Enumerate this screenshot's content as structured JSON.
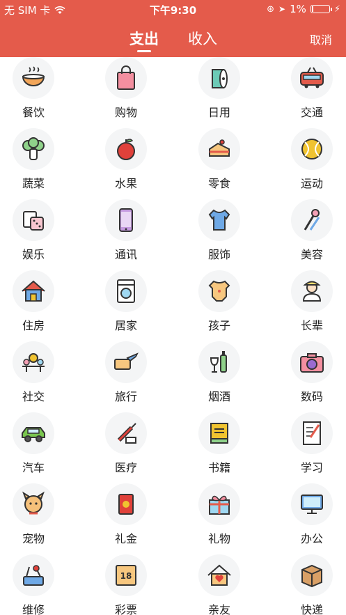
{
  "status": {
    "carrier": "无 SIM 卡",
    "time": "下午9:30",
    "battery": "1%"
  },
  "tabs": [
    "支出",
    "收入"
  ],
  "cancel": "取消",
  "categories": [
    {
      "label": "餐饮",
      "icon": "bowl-icon"
    },
    {
      "label": "购物",
      "icon": "shopping-bag-icon"
    },
    {
      "label": "日用",
      "icon": "paper-roll-icon"
    },
    {
      "label": "交通",
      "icon": "train-icon"
    },
    {
      "label": "蔬菜",
      "icon": "vegetable-icon"
    },
    {
      "label": "水果",
      "icon": "apple-icon"
    },
    {
      "label": "零食",
      "icon": "cake-icon"
    },
    {
      "label": "运动",
      "icon": "ball-icon"
    },
    {
      "label": "娱乐",
      "icon": "dice-icon"
    },
    {
      "label": "通讯",
      "icon": "phone-icon"
    },
    {
      "label": "服饰",
      "icon": "tshirt-icon"
    },
    {
      "label": "美容",
      "icon": "makeup-brush-icon"
    },
    {
      "label": "住房",
      "icon": "house-icon"
    },
    {
      "label": "居家",
      "icon": "washing-machine-icon"
    },
    {
      "label": "孩子",
      "icon": "baby-clothes-icon"
    },
    {
      "label": "长辈",
      "icon": "elder-icon"
    },
    {
      "label": "社交",
      "icon": "dinner-table-icon"
    },
    {
      "label": "旅行",
      "icon": "plane-ticket-icon"
    },
    {
      "label": "烟酒",
      "icon": "wine-icon"
    },
    {
      "label": "数码",
      "icon": "camera-icon"
    },
    {
      "label": "汽车",
      "icon": "car-icon"
    },
    {
      "label": "医疗",
      "icon": "syringe-icon"
    },
    {
      "label": "书籍",
      "icon": "book-icon"
    },
    {
      "label": "学习",
      "icon": "notebook-icon"
    },
    {
      "label": "宠物",
      "icon": "dog-icon"
    },
    {
      "label": "礼金",
      "icon": "red-envelope-icon"
    },
    {
      "label": "礼物",
      "icon": "gift-icon"
    },
    {
      "label": "办公",
      "icon": "monitor-icon"
    },
    {
      "label": "维修",
      "icon": "repair-icon"
    },
    {
      "label": "彩票",
      "icon": "lottery-icon"
    },
    {
      "label": "亲友",
      "icon": "heart-house-icon"
    },
    {
      "label": "快递",
      "icon": "package-icon"
    }
  ]
}
